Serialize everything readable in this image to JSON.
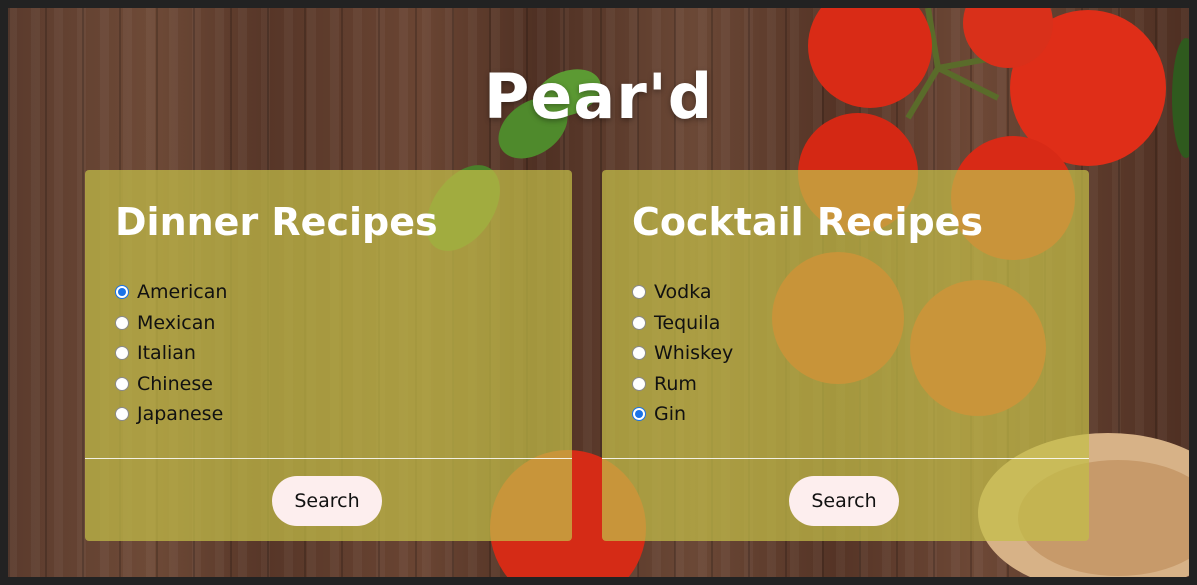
{
  "app": {
    "title": "Pear'd"
  },
  "dinner": {
    "heading": "Dinner Recipes",
    "options": [
      {
        "label": "American",
        "checked": true
      },
      {
        "label": "Mexican",
        "checked": false
      },
      {
        "label": "Italian",
        "checked": false
      },
      {
        "label": "Chinese",
        "checked": false
      },
      {
        "label": "Japanese",
        "checked": false
      }
    ],
    "search_label": "Search"
  },
  "cocktail": {
    "heading": "Cocktail Recipes",
    "options": [
      {
        "label": "Vodka",
        "checked": false
      },
      {
        "label": "Tequila",
        "checked": false
      },
      {
        "label": "Whiskey",
        "checked": false
      },
      {
        "label": "Rum",
        "checked": false
      },
      {
        "label": "Gin",
        "checked": true
      }
    ],
    "search_label": "Search"
  },
  "colors": {
    "card_overlay": "#c4be48",
    "radio_accent": "#1a73e8",
    "button_bg": "#fdeeee",
    "background_wood": "#5b3b2d"
  }
}
